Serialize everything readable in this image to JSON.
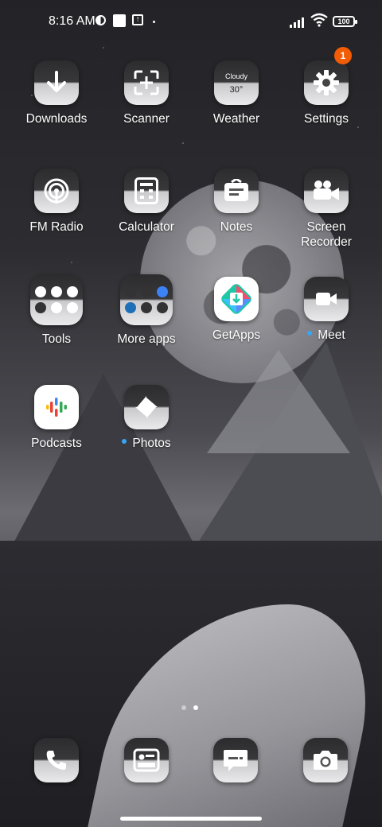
{
  "status_bar": {
    "time": "8:16 AM",
    "battery": "100",
    "icons": [
      "data-saver-icon",
      "square-icon",
      "upload-box-icon",
      "dot-icon",
      "signal-icon",
      "wifi-icon",
      "battery-icon"
    ]
  },
  "apps": {
    "downloads": {
      "label": "Downloads",
      "icon": "download-arrow-icon"
    },
    "scanner": {
      "label": "Scanner",
      "icon": "scan-frame-icon"
    },
    "weather": {
      "label": "Weather",
      "condition": "Cloudy",
      "temp": "30°",
      "icon": "weather-icon"
    },
    "settings": {
      "label": "Settings",
      "badge": "1",
      "icon": "gear-icon"
    },
    "fm_radio": {
      "label": "FM Radio",
      "icon": "radio-waves-icon"
    },
    "calculator": {
      "label": "Calculator",
      "icon": "calculator-icon"
    },
    "notes": {
      "label": "Notes",
      "icon": "notes-icon"
    },
    "screen_recorder": {
      "label": "Screen\nRecorder",
      "icon": "video-camera-icon"
    },
    "tools": {
      "label": "Tools",
      "icon": "folder-icon"
    },
    "more_apps": {
      "label": "More apps",
      "icon": "folder-icon"
    },
    "getapps": {
      "label": "GetApps",
      "icon": "getapps-icon"
    },
    "meet": {
      "label": "Meet",
      "icon": "meet-camera-icon"
    },
    "podcasts": {
      "label": "Podcasts",
      "icon": "podcasts-icon"
    },
    "photos": {
      "label": "Photos",
      "icon": "pinwheel-icon"
    }
  },
  "dock": [
    "phone-icon",
    "gallery-icon",
    "messages-icon",
    "camera-icon"
  ],
  "pages": {
    "count": 2,
    "active": 1
  },
  "colors": {
    "badge": "#f25c05",
    "new_dot": "#35a7f5"
  }
}
